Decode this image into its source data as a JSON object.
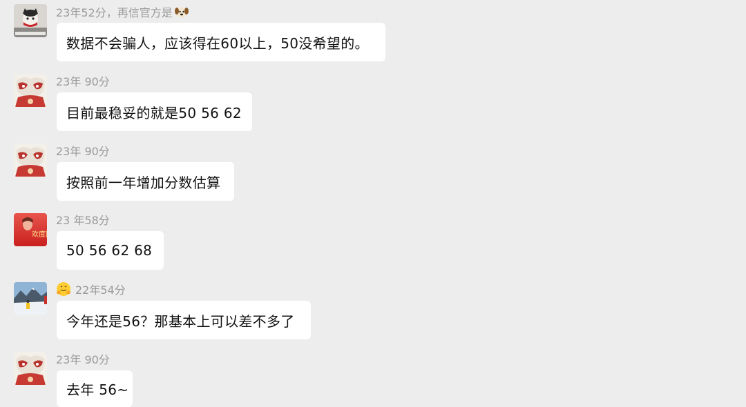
{
  "chat": {
    "messages": [
      {
        "sender": "23年52分，再信官方是",
        "text": "数据不会骗人，应该得在60以上，50没希望的。",
        "avatar_icon": "cat-avatar-icon",
        "sender_emoji": "dog-face-icon"
      },
      {
        "sender": "23年 90分",
        "text": "目前最稳妥的就是50 56 62",
        "avatar_icon": "lion-dance-avatar-icon"
      },
      {
        "sender": "23年 90分",
        "text": "按照前一年增加分数估算",
        "avatar_icon": "lion-dance-avatar-icon"
      },
      {
        "sender": "23 年58分",
        "text": "50 56  62  68",
        "avatar_icon": "red-festive-avatar-icon",
        "avatar_text": "欢度国庆"
      },
      {
        "sender": "22年54分",
        "text": "今年还是56？那基本上可以差不多了",
        "avatar_icon": "snow-mountain-avatar-icon",
        "sender_emoji": "hugging-face-icon"
      },
      {
        "sender": "23年 90分",
        "text": "去年 56~",
        "avatar_icon": "lion-dance-avatar-icon"
      }
    ]
  }
}
